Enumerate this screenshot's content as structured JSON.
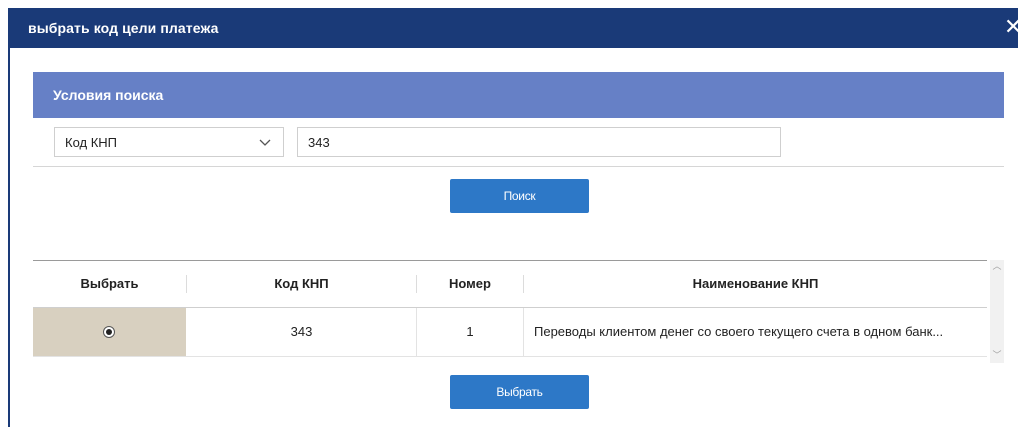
{
  "dialog": {
    "title": "выбрать код цели платежа",
    "close_glyph": "✕"
  },
  "search_panel": {
    "title": "Условия поиска",
    "field_select": {
      "selected": "Код КНП",
      "icon": "chevron-down-icon"
    },
    "search_value": "343",
    "search_button": "Поиск"
  },
  "table": {
    "columns": [
      "Выбрать",
      "Код КНП",
      "Номер",
      "Наименование КНП"
    ],
    "rows": [
      {
        "selected": true,
        "code": "343",
        "number": "1",
        "name": "Переводы клиентом денег со своего текущего счета в одном банк..."
      }
    ]
  },
  "choose_button": "Выбрать",
  "colors": {
    "titlebar": "#1a3a78",
    "panel_header": "#6680c6",
    "button": "#2d78c7",
    "selected_cell": "#d8d0c0"
  }
}
